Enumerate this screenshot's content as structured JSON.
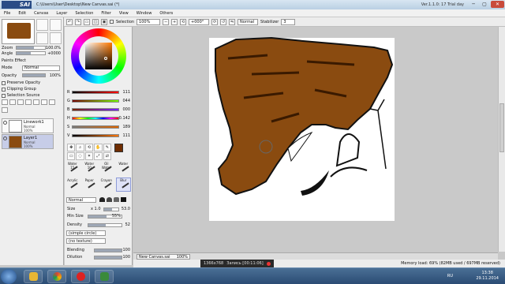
{
  "app": {
    "logo": "SAI",
    "title": "C:\\Users\\User\\Desktop\\New Canvas.sai (*)",
    "version": "Ver.1.1.0: 17 Trial day"
  },
  "menu": [
    "File",
    "Edit",
    "Canvas",
    "Layer",
    "Selection",
    "Filter",
    "View",
    "Window",
    "Others"
  ],
  "toolbar": {
    "selection_label": "Selection",
    "zoom_value": "100%",
    "rotation_value": "+000°",
    "blend_mode": "Normal",
    "stabilizer_label": "Stabilizer",
    "stabilizer_value": "3"
  },
  "navigator": {
    "zoom_label": "Zoom",
    "zoom_value": "100.0%",
    "angle_label": "Angle",
    "angle_value": "+0000"
  },
  "layer_panel": {
    "paint_effect": "Paints Effect",
    "mode_label": "Mode",
    "mode_value": "Normal",
    "opacity_label": "Opacity",
    "opacity_value": "100%",
    "preserve_opacity": "Preserve Opacity",
    "clipping_group": "Clipping Group",
    "selection_source": "Selection Source",
    "layers": [
      {
        "name": "Linework1",
        "mode": "Normal",
        "opacity": "100%"
      },
      {
        "name": "Layer1",
        "mode": "Normal",
        "opacity": "100%"
      }
    ]
  },
  "color_sliders": [
    {
      "label": "R",
      "value": "111"
    },
    {
      "label": "G",
      "value": "044"
    },
    {
      "label": "B",
      "value": "000"
    },
    {
      "label": "H",
      "value": "0.142"
    },
    {
      "label": "S",
      "value": "189"
    },
    {
      "label": "V",
      "value": "111"
    }
  ],
  "brushes": [
    {
      "name": "Water",
      "size": "15"
    },
    {
      "name": "Water",
      "size": "10"
    },
    {
      "name": "Oil Water",
      "size": ""
    },
    {
      "name": "Water",
      "size": ""
    },
    {
      "name": "Acrylic",
      "size": ""
    },
    {
      "name": "Paper",
      "size": ""
    },
    {
      "name": "Crayon",
      "size": ""
    },
    {
      "name": "Blur",
      "size": ""
    }
  ],
  "brush_settings": {
    "mode": "Normal",
    "size_label": "Size",
    "size_mult": "x 1.0",
    "size_value": "53.0",
    "minsize_label": "Min Size",
    "minsize_value": "55%",
    "density_label": "Density",
    "density_value": "52",
    "shape": "(simple circle)",
    "texture": "(no texture)",
    "blending_label": "Blending",
    "blending_value": "100",
    "dilution_label": "Dilution",
    "dilution_value": "100"
  },
  "canvas_tab": {
    "name": "New Canvas.sai",
    "zoom": "100%"
  },
  "recorder": {
    "resolution": "1366x768",
    "status": "Запись [00:11:06]"
  },
  "status": {
    "memory": "Memory load: 69% (82MB used / 697MB reserved)"
  },
  "taskbar": {
    "lang": "RU",
    "time": "13:38",
    "date": "29.11.2014"
  },
  "colors": {
    "foreground": "#6f2c00",
    "hair": "#8a4b10",
    "selected_layer": "#c7cde8"
  }
}
